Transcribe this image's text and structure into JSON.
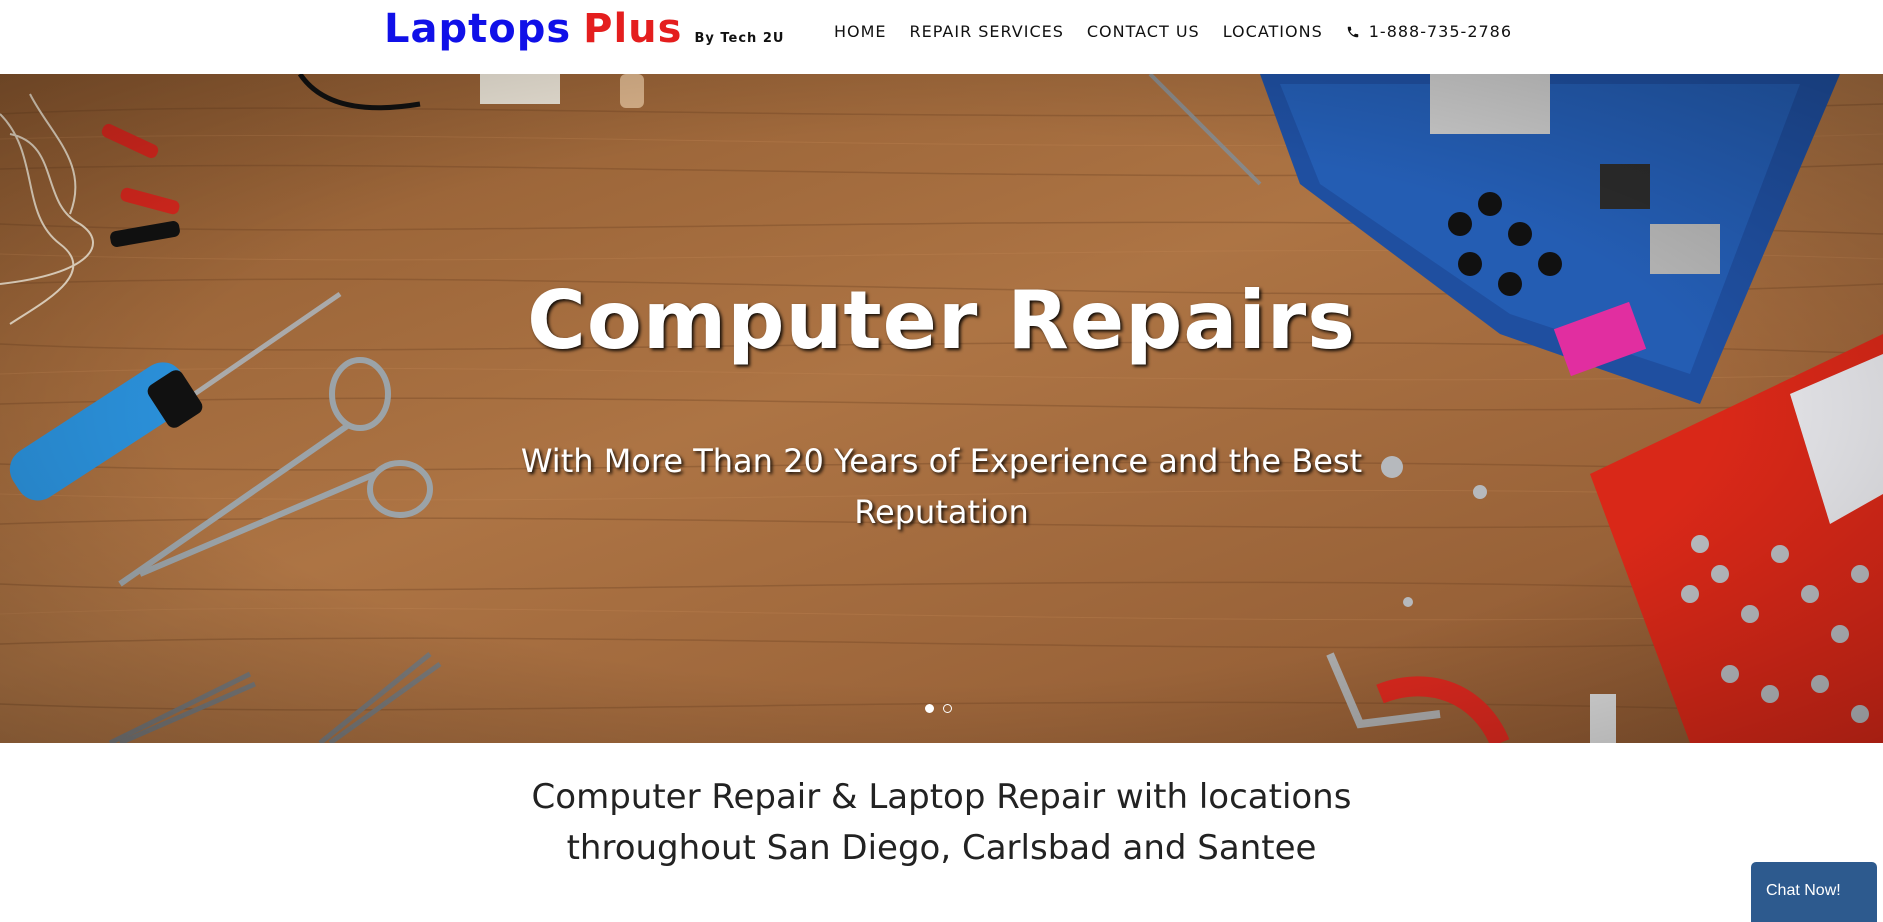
{
  "header": {
    "logo": {
      "laptops": "Laptops",
      "plus": "Plus",
      "byline": "By Tech 2U"
    },
    "nav": [
      {
        "label": "HOME"
      },
      {
        "label": "REPAIR SERVICES"
      },
      {
        "label": "CONTACT US"
      },
      {
        "label": "LOCATIONS"
      }
    ],
    "phone": "1-888-735-2786",
    "phone_icon": "phone-icon"
  },
  "hero": {
    "title": "Computer Repairs",
    "subtitle": "With More Than 20 Years of Experience and the Best Reputation",
    "slides_total": 2,
    "active_slide": 1
  },
  "intro": {
    "heading": "Computer Repair & Laptop Repair with locations throughout San Diego, Carlsbad and Santee"
  },
  "chat": {
    "label": "Chat Now!"
  },
  "colors": {
    "logo_blue": "#1010e8",
    "logo_red": "#e41e1e",
    "chat_bg": "#2d5a8e",
    "wood": "#a4693a"
  }
}
